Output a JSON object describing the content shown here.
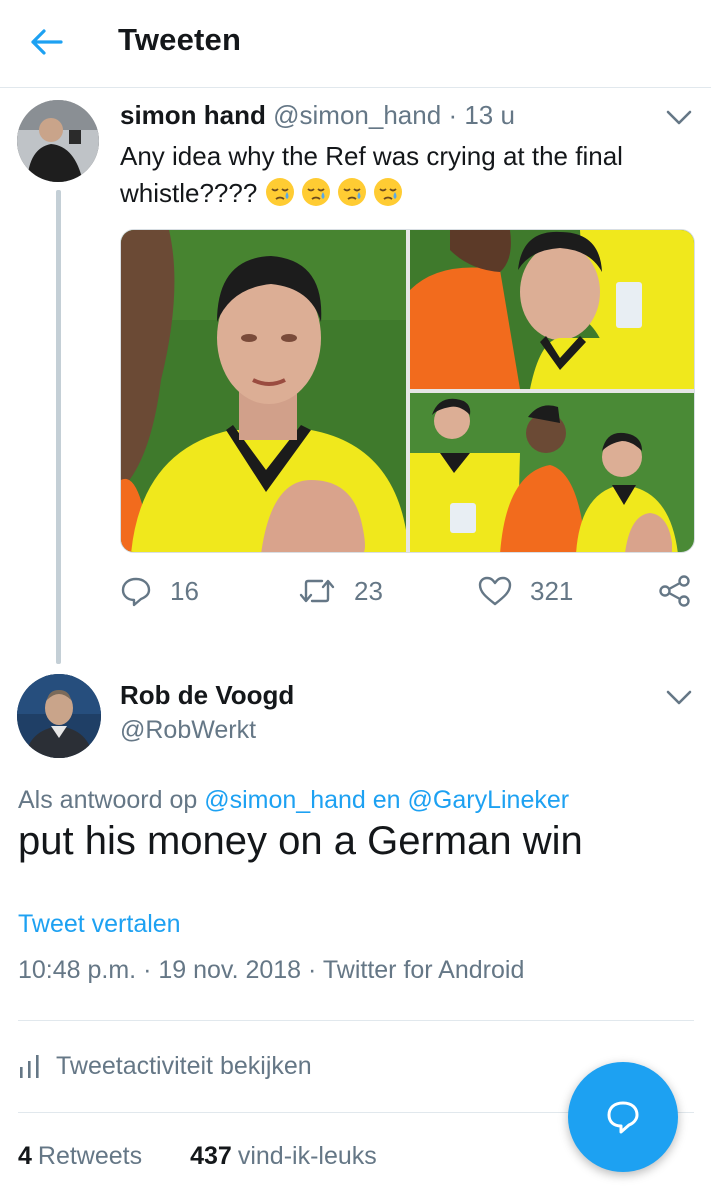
{
  "header": {
    "title": "Tweeten"
  },
  "parent_tweet": {
    "name": "simon hand",
    "handle": "@simon_hand",
    "separator": "·",
    "time": "13 u",
    "text": "Any idea why the Ref was crying at the final whistle????",
    "emoji_count": 4,
    "replies": "16",
    "retweets": "23",
    "likes": "321"
  },
  "focused_tweet": {
    "name": "Rob de Voogd",
    "handle": "@RobWerkt",
    "reply_prefix": "Als antwoord op",
    "reply_mention_1": "@simon_hand",
    "reply_conjunction": "en",
    "reply_mention_2": "@GaryLineker",
    "text": "put his money on a German win",
    "translate_label": "Tweet vertalen",
    "time": "10:48 p.m.",
    "separator_1": "·",
    "date": "19 nov. 2018",
    "separator_2": "·",
    "source": "Twitter for Android",
    "activity_label": "Tweetactiviteit bekijken",
    "retweets_count": "4",
    "retweets_label": "Retweets",
    "likes_count": "437",
    "likes_label": "vind-ik-leuks"
  },
  "colors": {
    "accent": "#1da1f2",
    "secondary_text": "#657786",
    "divider": "#e1e8ed",
    "referee_shirt": "#f0e81c",
    "orange_shirt": "#f26b1d",
    "pitch": "#3f7a2c"
  }
}
